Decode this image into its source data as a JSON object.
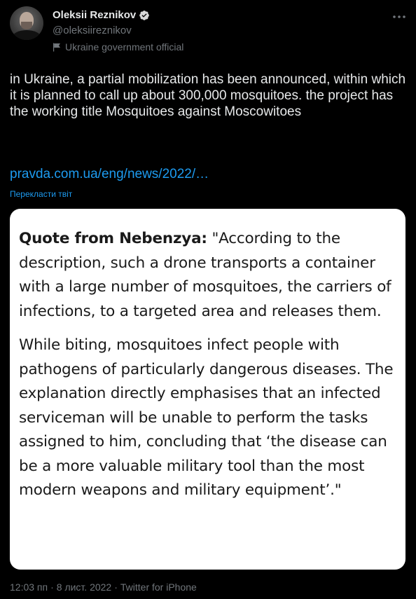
{
  "author": {
    "display_name": "Oleksii Reznikov",
    "handle": "@oleksiireznikov",
    "affiliation": "Ukraine government official",
    "verified": true
  },
  "tweet": {
    "text": "in Ukraine, a partial mobilization has been announced, within which it is planned to call up about 300,000 mosquitoes. the project has the working title Mosquitoes against Moscowitoes",
    "link": "pravda.com.ua/eng/news/2022/…",
    "translate_label": "Перекласти твіт"
  },
  "media": {
    "quote_lead": "Quote from Nebenzya:",
    "quote_para1": " \"According to the description, such a drone transports a container with a large number of mosquitoes, the carriers of infections, to a targeted area and releases them.",
    "quote_para2": "While biting, mosquitoes infect people with pathogens of particularly dangerous diseases. The explanation directly emphasises that an infected serviceman will be unable to perform the tasks assigned to him, concluding that ‘the disease can be a more valuable military tool than the most modern weapons and military equipment’.\""
  },
  "meta": {
    "time": "12:03 пп",
    "separator": "·",
    "date": "8 лист. 2022",
    "source": "Twitter for iPhone"
  },
  "colors": {
    "background": "#000000",
    "text": "#e7e9ea",
    "secondary": "#71767b",
    "accent": "#1d9bf0"
  },
  "icons": {
    "verified": "verified-badge-icon",
    "affiliation": "flag-icon",
    "more": "more-options-icon"
  }
}
